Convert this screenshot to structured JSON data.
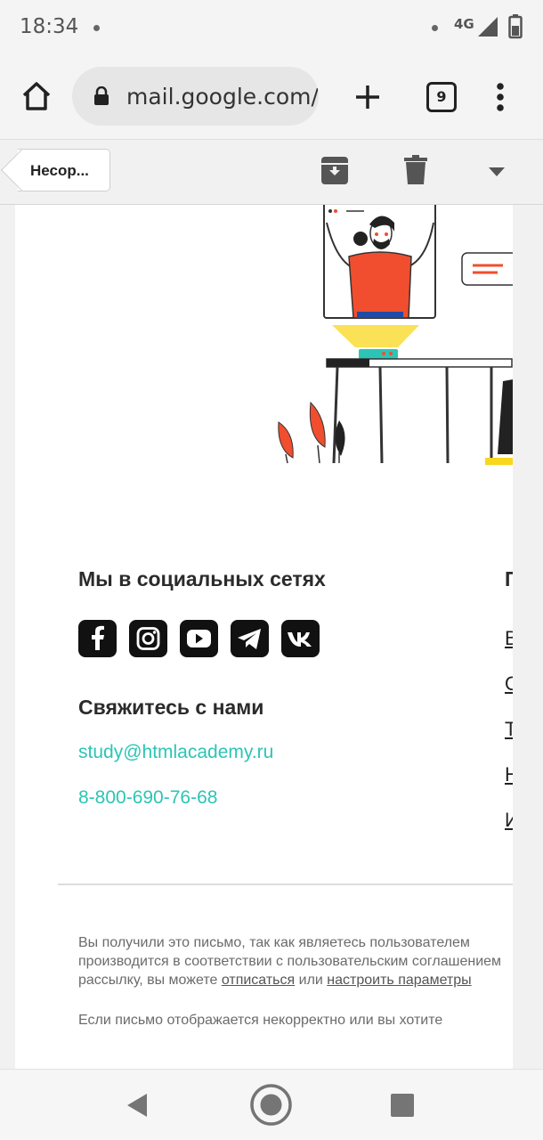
{
  "status_bar": {
    "time": "18:34",
    "network": "4G"
  },
  "browser": {
    "url": "mail.google.com/",
    "tab_count": "9"
  },
  "gmail_toolbar": {
    "back_label": "Несор..."
  },
  "email": {
    "social_heading": "Мы в социальных сетях",
    "social_links": [
      "facebook",
      "instagram",
      "youtube",
      "telegram",
      "vk"
    ],
    "contact_heading": "Свяжитесь с нами",
    "contact_email": "study@htmlacademy.ru",
    "contact_phone": "8-800-690-76-68",
    "right_column_heading": "П",
    "right_column_links": [
      "В",
      "О",
      "Т",
      "Н",
      "И"
    ],
    "footer": {
      "line1": "Вы получили это письмо, так как являетесь пользователем",
      "line2": "производится в соответствии с пользовательским соглашением",
      "line3_prefix": "рассылку, вы можете ",
      "unsubscribe": "отписаться",
      "line3_mid": " или ",
      "settings": "настроить параметры",
      "line4": "Если письмо отображается некорректно или вы хотите"
    }
  },
  "colors": {
    "accent_teal": "#2cc5b5",
    "illustration_red": "#f04e2e",
    "illustration_yellow": "#f8d71c"
  }
}
